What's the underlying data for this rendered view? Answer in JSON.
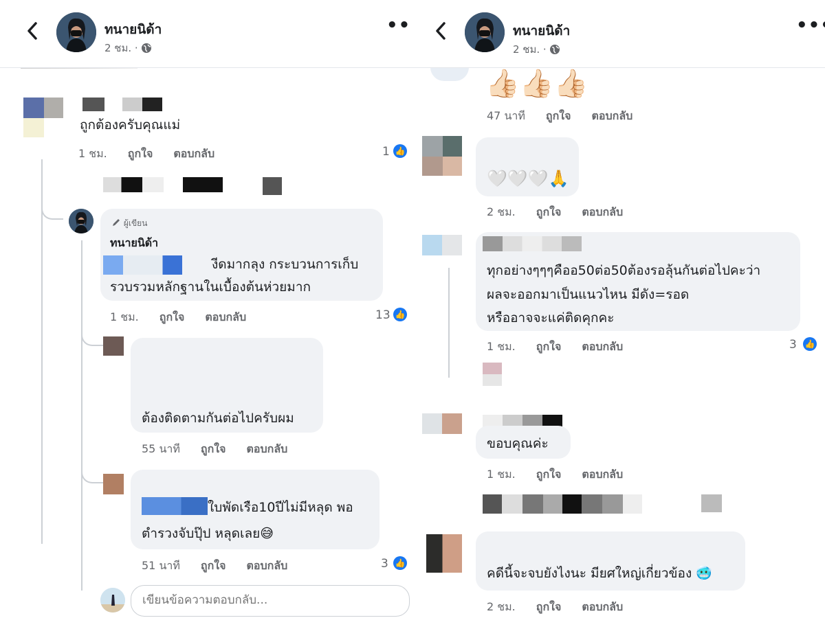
{
  "left": {
    "header": {
      "name": "ทนายนิด้า",
      "time": "2 ชม. · "
    },
    "comment1": {
      "text": "ถูกต้องครับคุณแม่",
      "time": "1 ชม.",
      "like": "ถูกใจ",
      "reply": "ตอบกลับ",
      "reactions": "1"
    },
    "author_reply": {
      "badge": "ผู้เขียน",
      "name": "ทนายนิด้า",
      "line1": "งีดมากลุง กระบวนการเก็บ",
      "line2": "รวบรวมหลักฐานในเบื้องต้นห่วยมาก",
      "time": "1 ชม.",
      "like": "ถูกใจ",
      "reply": "ตอบกลับ",
      "reactions": "13"
    },
    "reply2": {
      "text": "ต้องติดตามกันต่อไปครับผม",
      "time": "55 นาที",
      "like": "ถูกใจ",
      "reply": "ตอบกลับ"
    },
    "reply3": {
      "line1": "ใบพัดเรือ10ปีไม่มีหลุด พอ",
      "line2": "ตำรวงจับปุ๊ป หลุดเลย😅",
      "time": "51 นาที",
      "like": "ถูกใจ",
      "reply": "ตอบกลับ",
      "reactions": "3"
    },
    "input": {
      "placeholder": "เขียนข้อความตอบกลับ..."
    }
  },
  "right": {
    "header": {
      "name": "ทนายนิด้า",
      "time": "2 ชม. · "
    },
    "c0": {
      "emoji": "👍🏻👍🏻👍🏻",
      "time": "47 นาที",
      "like": "ถูกใจ",
      "reply": "ตอบกลับ"
    },
    "c1": {
      "emoji": "🤍🤍🤍🙏",
      "time": "2 ชม.",
      "like": "ถูกใจ",
      "reply": "ตอบกลับ"
    },
    "c2": {
      "line1": "ทุกอย่างๆๆๆคืออ50ต่อ50ต้องรอลุ้นกันต่อไปคะว่า",
      "line2": "ผลจะออกมาเป็นแนวไหน มีดัง=รอด",
      "line3": "หรืออาจจะแค่ติดคุกคะ",
      "time": "1 ชม.",
      "like": "ถูกใจ",
      "reply": "ตอบกลับ",
      "reactions": "3"
    },
    "c3": {
      "text": "ขอบคุณค่ะ",
      "time": "1 ชม.",
      "like": "ถูกใจ",
      "reply": "ตอบกลับ"
    },
    "c4": {
      "text": "คดีนี้จะจบยังไงนะ มียศใหญ่เกี่ยวข้อง 🥶",
      "time": "2 ชม.",
      "like": "ถูกใจ",
      "reply": "ตอบกลับ"
    }
  },
  "icons": {
    "back": "back-arrow-icon",
    "more": "more-options-icon",
    "globe": "globe-icon",
    "like": "like-thumb-icon",
    "edit": "pencil-icon"
  },
  "colors": {
    "like_blue": "#1877f2",
    "bubble": "#f0f2f5",
    "meta_gray": "#65676b"
  }
}
